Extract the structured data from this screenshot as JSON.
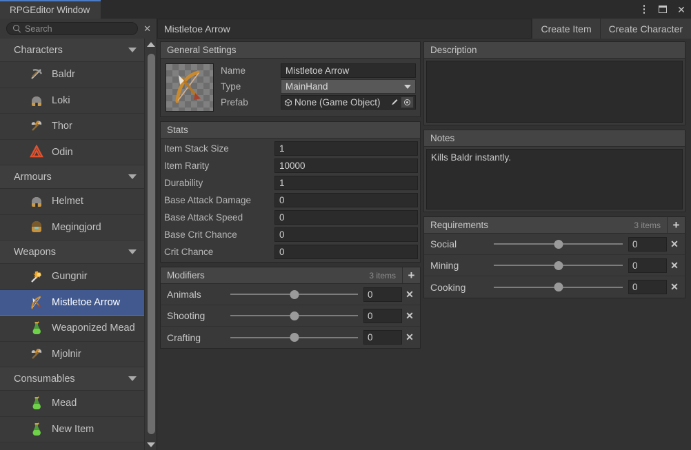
{
  "window": {
    "tab_label": "RPGEditor Window",
    "controls": {
      "menu": "kebab-menu",
      "maximize": "maximize",
      "close": "✕"
    }
  },
  "sidebar": {
    "search": {
      "placeholder": "Search",
      "value": "",
      "clear": "✕"
    },
    "groups": [
      {
        "label": "Characters",
        "items": [
          {
            "label": "Baldr",
            "icon": "pickaxe-icon"
          },
          {
            "label": "Loki",
            "icon": "helmet-icon"
          },
          {
            "label": "Thor",
            "icon": "axe-icon"
          },
          {
            "label": "Odin",
            "icon": "valknut-icon"
          }
        ]
      },
      {
        "label": "Armours",
        "items": [
          {
            "label": "Helmet",
            "icon": "helmet-icon"
          },
          {
            "label": "Megingjord",
            "icon": "belt-icon"
          }
        ]
      },
      {
        "label": "Weapons",
        "items": [
          {
            "label": "Gungnir",
            "icon": "mace-icon"
          },
          {
            "label": "Mistletoe Arrow",
            "icon": "bow-icon",
            "selected": true
          },
          {
            "label": "Weaponized Mead",
            "icon": "potion-icon"
          },
          {
            "label": "Mjolnir",
            "icon": "axe-icon"
          }
        ]
      },
      {
        "label": "Consumables",
        "items": [
          {
            "label": "Mead",
            "icon": "potion-icon"
          },
          {
            "label": "New Item",
            "icon": "potion-icon"
          }
        ]
      }
    ]
  },
  "toolbar": {
    "title_value": "Mistletoe Arrow",
    "create_item_label": "Create Item",
    "create_character_label": "Create Character"
  },
  "general_settings": {
    "header": "General Settings",
    "name_label": "Name",
    "name_value": "Mistletoe Arrow",
    "type_label": "Type",
    "type_value": "MainHand",
    "prefab_label": "Prefab",
    "prefab_value": "None (Game Object)"
  },
  "stats": {
    "header": "Stats",
    "rows": [
      {
        "label": "Item Stack Size",
        "value": "1"
      },
      {
        "label": "Item Rarity",
        "value": "10000"
      },
      {
        "label": "Durability",
        "value": "1"
      },
      {
        "label": "Base Attack Damage",
        "value": "0"
      },
      {
        "label": "Base Attack Speed",
        "value": "0"
      },
      {
        "label": "Base Crit Chance",
        "value": "0"
      },
      {
        "label": "Crit Chance",
        "value": "0"
      }
    ]
  },
  "modifiers": {
    "header": "Modifiers",
    "count_label": "3 items",
    "add_label": "+",
    "rows": [
      {
        "label": "Animals",
        "value": "0",
        "slider_pct": 50
      },
      {
        "label": "Shooting",
        "value": "0",
        "slider_pct": 50
      },
      {
        "label": "Crafting",
        "value": "0",
        "slider_pct": 50
      }
    ]
  },
  "description": {
    "header": "Description",
    "value": ""
  },
  "notes": {
    "header": "Notes",
    "value": "Kills Baldr instantly."
  },
  "requirements": {
    "header": "Requirements",
    "count_label": "3 items",
    "add_label": "+",
    "rows": [
      {
        "label": "Social",
        "value": "0",
        "slider_pct": 50
      },
      {
        "label": "Mining",
        "value": "0",
        "slider_pct": 50
      },
      {
        "label": "Cooking",
        "value": "0",
        "slider_pct": 50
      }
    ]
  },
  "colors": {
    "accent": "#4b7bc4",
    "selection": "#41598f",
    "background": "#323232",
    "panel": "#393939",
    "panel_header": "#444444"
  }
}
